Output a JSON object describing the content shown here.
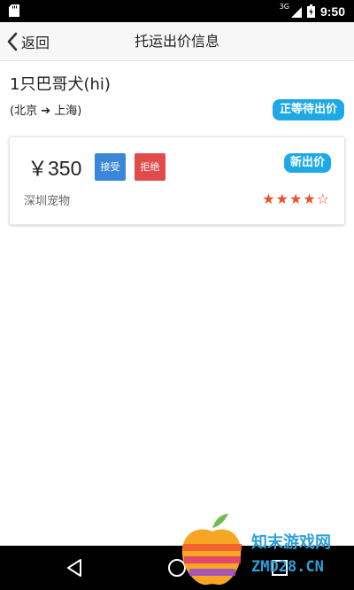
{
  "status_bar": {
    "network": "3G",
    "time": "9:50"
  },
  "header": {
    "back_label": "返回",
    "title": "托运出价信息"
  },
  "shipment": {
    "title": "1只巴哥犬(hi)",
    "route": "(北京 ➔ 上海)",
    "status": "正等待出价"
  },
  "offer": {
    "price": "￥350",
    "accept_label": "接受",
    "reject_label": "拒绝",
    "badge": "新出价",
    "shop_name": "深圳宠物",
    "rating": 4,
    "rating_max": 5,
    "stars_text": "★★★★☆"
  },
  "watermark": {
    "line1": "知末游戏网",
    "line2": "ZMD28.CN"
  },
  "colors": {
    "badge_blue": "#1ea8e6",
    "accept_blue": "#3a86d8",
    "reject_red": "#e04c4c",
    "star_orange": "#e8532a"
  }
}
